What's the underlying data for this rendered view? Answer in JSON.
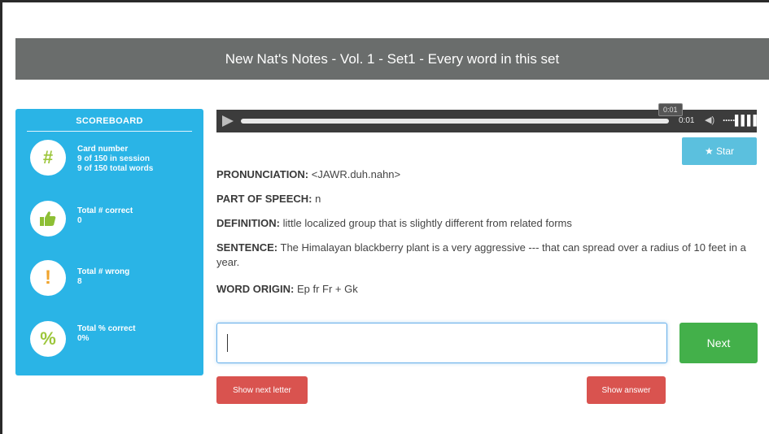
{
  "title": "New Nat's Notes - Vol. 1 - Set1 - Every word in this set",
  "scoreboard": {
    "heading": "SCOREBOARD",
    "items": [
      {
        "icon": "hash-icon",
        "glyph": "#",
        "label": "Card number",
        "lines": [
          "9 of 150 in session",
          "9 of 150 total words"
        ]
      },
      {
        "icon": "thumbs-up-icon",
        "glyph": "👍",
        "label": "Total # correct",
        "lines": [
          "0"
        ]
      },
      {
        "icon": "exclamation-icon",
        "glyph": "!",
        "label": "Total # wrong",
        "lines": [
          "8"
        ]
      },
      {
        "icon": "percent-icon",
        "glyph": "%",
        "label": "Total % correct",
        "lines": [
          "0%"
        ]
      }
    ]
  },
  "audio": {
    "time_bubble": "0:01",
    "time_label": "0:01",
    "volume_bars": "·····▌▌▌▌"
  },
  "star_label": "★ Star",
  "card": {
    "pronunciation_label": "PRONUNCIATION:",
    "pronunciation": "<JAWR.duh.nahn>",
    "pos_label": "PART OF SPEECH:",
    "pos": "n",
    "definition_label": "DEFINITION:",
    "definition": "little localized group that is slightly different from related forms",
    "sentence_label": "SENTENCE:",
    "sentence": "The Himalayan blackberry plant is a very aggressive --- that can spread over a radius of 10 feet in a year.",
    "origin_label": "WORD ORIGIN:",
    "origin": "Ep fr Fr + Gk"
  },
  "answer_value": "",
  "next_label": "Next",
  "show_next_letter_label": "Show next letter",
  "show_answer_label": "Show answer",
  "colors": {
    "title_bar": "#6a6d6c",
    "scoreboard": "#2ab4e6",
    "next": "#43b04a",
    "danger": "#d9534f",
    "star": "#5bc0de"
  }
}
